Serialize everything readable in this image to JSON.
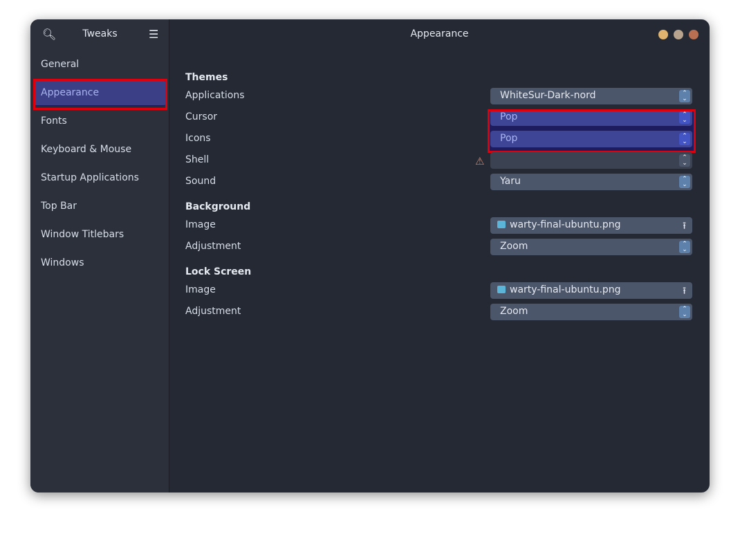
{
  "sidebar": {
    "title": "Tweaks",
    "items": [
      "General",
      "Appearance",
      "Fonts",
      "Keyboard & Mouse",
      "Startup Applications",
      "Top Bar",
      "Window Titlebars",
      "Windows"
    ],
    "selected": "Appearance"
  },
  "header": {
    "title": "Appearance",
    "window_buttons": {
      "minimize": "#e0b36f",
      "maximize": "#b8a48e",
      "close": "#b86f52"
    }
  },
  "themes": {
    "heading": "Themes",
    "applications": {
      "label": "Applications",
      "value": "WhiteSur-Dark-nord"
    },
    "cursor": {
      "label": "Cursor",
      "value": "Pop"
    },
    "icons": {
      "label": "Icons",
      "value": "Pop"
    },
    "shell": {
      "label": "Shell",
      "value": "",
      "warning": "warning-icon"
    },
    "sound": {
      "label": "Sound",
      "value": "Yaru"
    }
  },
  "background": {
    "heading": "Background",
    "image": {
      "label": "Image",
      "value": "warty-final-ubuntu.png"
    },
    "adjustment": {
      "label": "Adjustment",
      "value": "Zoom"
    }
  },
  "lock_screen": {
    "heading": "Lock Screen",
    "image": {
      "label": "Image",
      "value": "warty-final-ubuntu.png"
    },
    "adjustment": {
      "label": "Adjustment",
      "value": "Zoom"
    }
  },
  "colors": {
    "highlight": "#e0000d",
    "accent": "#3b3f86"
  }
}
